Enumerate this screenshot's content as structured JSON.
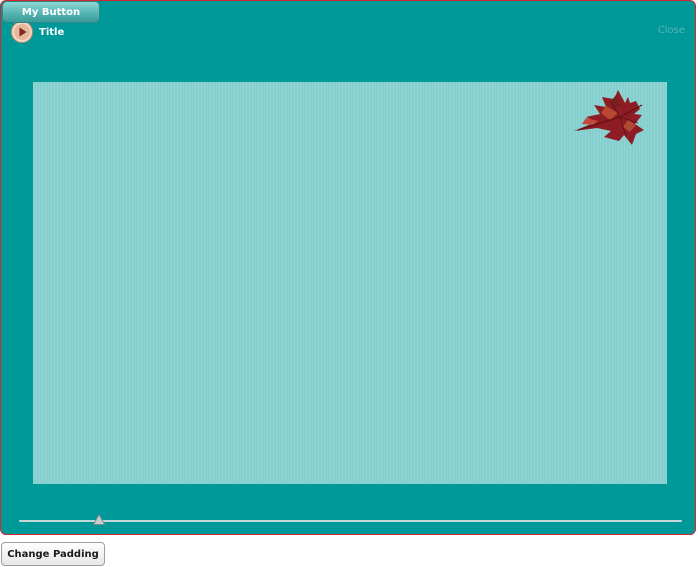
{
  "window": {
    "my_button_label": "My Button",
    "title": "Title",
    "close_label": "Close",
    "content": {
      "image_icon": "maple-leaf-icon"
    }
  },
  "slider": {
    "value": 0.12
  },
  "footer": {
    "change_padding_label": "Change Padding"
  },
  "colors": {
    "window_background": "#009999",
    "window_border": "#d0262e",
    "content_background": "#86cfcf",
    "button_gradient_top": "#8ed8d6",
    "button_gradient_bottom": "#3a9b99"
  }
}
